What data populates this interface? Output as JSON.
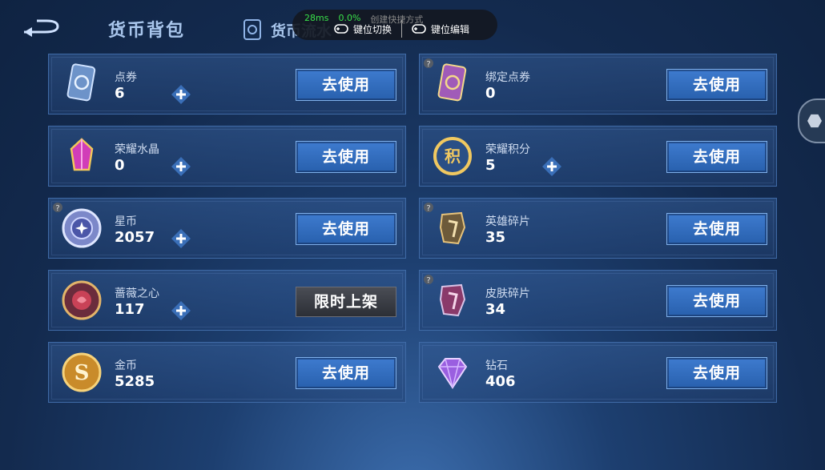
{
  "header": {
    "title": "货币背包",
    "tab_flow": "货币流水"
  },
  "overlay": {
    "ping": "28ms",
    "fps": "0.0%",
    "hint": "创建快捷方式",
    "key_switch": "键位切换",
    "key_edit": "键位编辑"
  },
  "items": [
    {
      "name": "点券",
      "count": "6",
      "action": "去使用"
    },
    {
      "name": "绑定点券",
      "count": "0",
      "action": "去使用"
    },
    {
      "name": "荣耀水晶",
      "count": "0",
      "action": "去使用"
    },
    {
      "name": "荣耀积分",
      "count": "5",
      "action": "去使用"
    },
    {
      "name": "星币",
      "count": "2057",
      "action": "去使用"
    },
    {
      "name": "英雄碎片",
      "count": "35",
      "action": "去使用"
    },
    {
      "name": "蔷薇之心",
      "count": "117",
      "action": "限时上架"
    },
    {
      "name": "皮肤碎片",
      "count": "34",
      "action": "去使用"
    },
    {
      "name": "金币",
      "count": "5285",
      "action": "去使用"
    },
    {
      "name": "钻石",
      "count": "406",
      "action": "去使用"
    }
  ],
  "colors": {
    "accent": "#2f6fc0",
    "card_border": "#3f6aa6",
    "title": "#a9c6ec"
  }
}
